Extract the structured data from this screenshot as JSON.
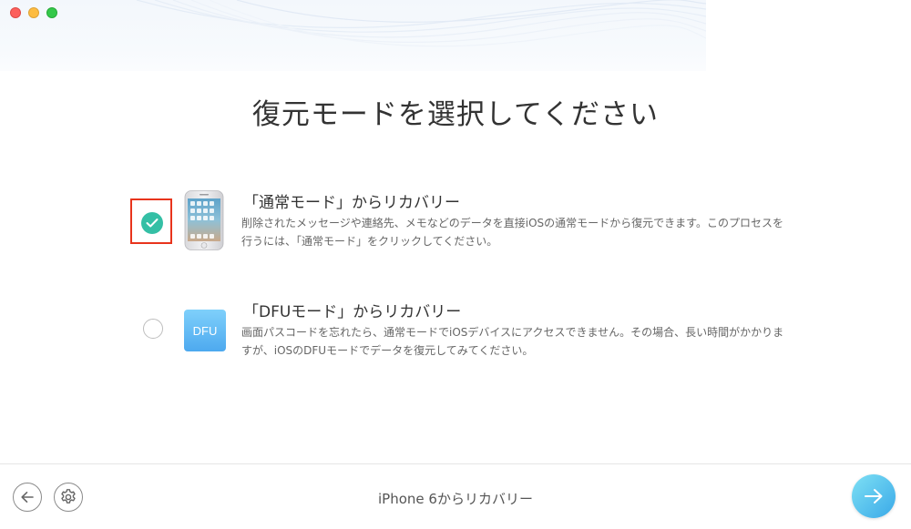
{
  "window": {
    "traffic_lights": [
      "close",
      "minimize",
      "zoom"
    ]
  },
  "page_title": "復元モードを選択してください",
  "options": [
    {
      "title": "「通常モード」からリカバリー",
      "description": "削除されたメッセージや連絡先、メモなどのデータを直接iOSの通常モードから復元できます。このプロセスを行うには、「通常モード」をクリックしてください。",
      "selected": true,
      "icon": "iphone-icon"
    },
    {
      "title": "「DFUモード」からリカバリー",
      "description": "画面パスコードを忘れたら、通常モードでiOSデバイスにアクセスできません。その場合、長い時間がかかりますが、iOSのDFUモードでデータを復元してみてください。",
      "selected": false,
      "icon": "dfu-icon",
      "icon_label": "DFU"
    }
  ],
  "footer": {
    "label": "iPhone 6からリカバリー",
    "back_icon": "arrow-left-icon",
    "settings_icon": "gear-icon",
    "next_icon": "arrow-right-icon"
  },
  "colors": {
    "accent_green": "#34bfa5",
    "highlight_red": "#e8341c",
    "next_button": "#3aa9e8"
  }
}
